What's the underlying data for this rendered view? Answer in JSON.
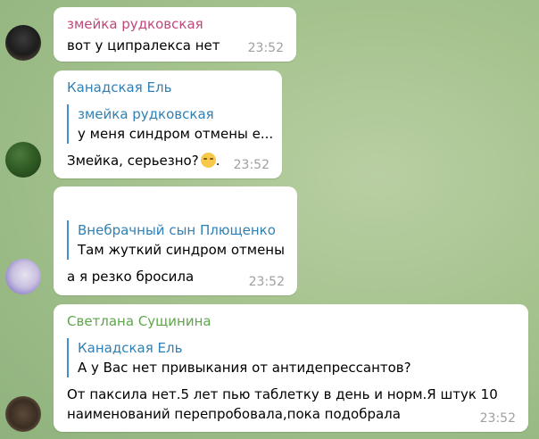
{
  "messages": [
    {
      "sender": "змейка рудковская",
      "text": "вот у ципралекса нет",
      "time": "23:52"
    },
    {
      "sender": "Канадская Ель",
      "reply_to": {
        "sender": "змейка рудковская",
        "text": "у меня синдром отмены е..."
      },
      "text": "Змейка, серьезно?",
      "text_suffix": ".",
      "emoji": "pensive-face-icon",
      "time": "23:52"
    },
    {
      "reply_to": {
        "sender": "Внебрачный сын Плющенко",
        "text": "Там жуткий синдром отмены"
      },
      "text": "а я резко бросила",
      "time": "23:52"
    },
    {
      "sender": "Светлана Сущинина",
      "reply_to": {
        "sender": "Канадская Ель",
        "text": "А у Вас нет привыкания от антидепрессантов?"
      },
      "text_line1": "От паксила нет.5 лет пью таблетку в день и норм.Я штук 10",
      "text_line2": "наименований перепробовала,пока подобрала",
      "time": "23:52"
    }
  ],
  "colors": {
    "sender_pink": "#c0477a",
    "sender_blue": "#2f80b5",
    "sender_green": "#5fa64b",
    "reply_bar": "#3f8fcf",
    "time": "#a0a0a0"
  }
}
